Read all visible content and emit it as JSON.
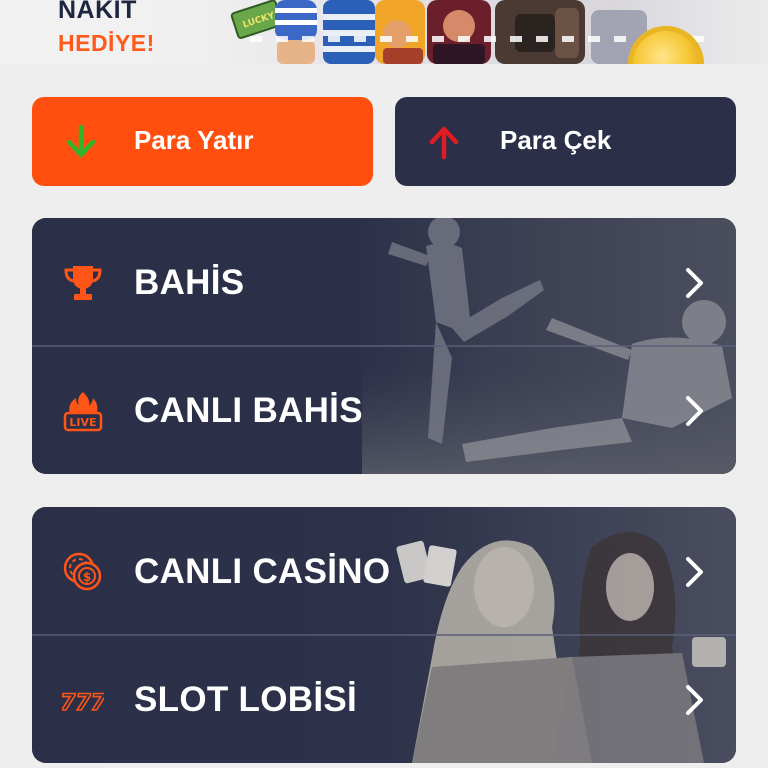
{
  "banner": {
    "line1": "NAKİT",
    "line2": "HEDİYE!",
    "badge_text": "LUCKY"
  },
  "actions": {
    "deposit": {
      "label": "Para Yatır",
      "icon": "arrow-down-icon",
      "color": "#ff4e0d",
      "icon_color": "#33b52b"
    },
    "withdraw": {
      "label": "Para Çek",
      "icon": "arrow-up-icon",
      "color": "#2b2f48",
      "icon_color": "#e01c24"
    }
  },
  "sports_panel": {
    "items": [
      {
        "label": "BAHİS",
        "icon": "trophy-icon"
      },
      {
        "label": "CANLI BAHİS",
        "icon": "live-fire-icon",
        "badge": "LIVE"
      }
    ]
  },
  "casino_panel": {
    "items": [
      {
        "label": "CANLI CASİNO",
        "icon": "casino-chip-icon"
      },
      {
        "label": "SLOT LOBİSİ",
        "icon": "slot-777-icon",
        "badge": "777"
      }
    ]
  },
  "colors": {
    "accent": "#ff4e0d",
    "panel": "#2b2f48",
    "background": "#efeeee",
    "icon_orange": "#ff5516"
  }
}
